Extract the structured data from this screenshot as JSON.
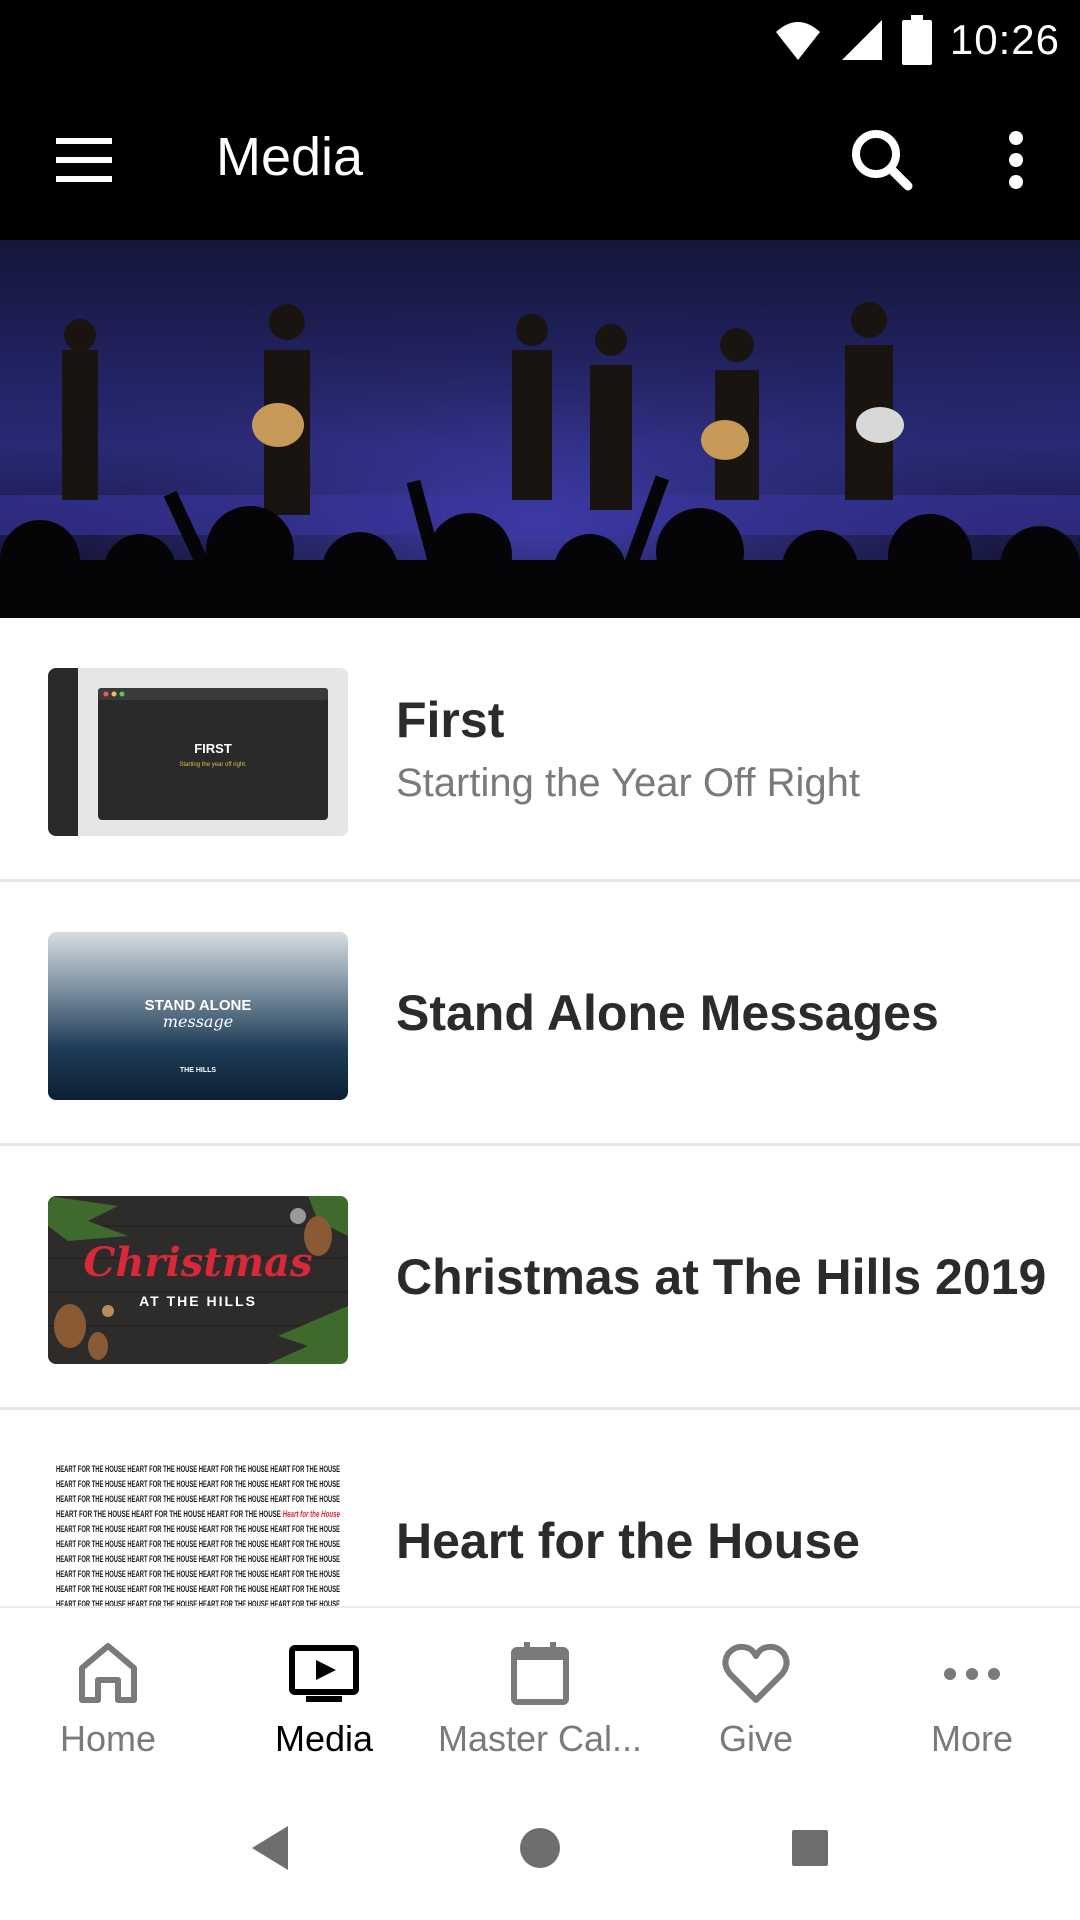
{
  "status_bar": {
    "time": "10:26",
    "icons": [
      "wifi-icon",
      "signal-icon",
      "battery-icon"
    ]
  },
  "app_bar": {
    "title": "Media",
    "icons": [
      "hamburger-menu-icon",
      "search-icon",
      "overflow-menu-icon"
    ]
  },
  "media_items": [
    {
      "title": "First",
      "subtitle": "Starting the Year Off Right",
      "thumb_text": "FIRST",
      "thumb_subtext": "Starting the year off right."
    },
    {
      "title": "Stand Alone Messages",
      "thumb_text": "STAND ALONE",
      "thumb_script": "message",
      "thumb_logo": "THE HILLS"
    },
    {
      "title": "Christmas at The Hills 2019",
      "thumb_script": "Christmas",
      "thumb_text": "AT THE HILLS"
    },
    {
      "title": "Heart for the House",
      "thumb_text": "HEART FOR THE HOUSE",
      "thumb_accent": "Heart for the House"
    }
  ],
  "bottom_nav": [
    {
      "label": "Home",
      "icon": "home-icon",
      "active": false
    },
    {
      "label": "Media",
      "icon": "media-play-icon",
      "active": true
    },
    {
      "label": "Master Cal...",
      "icon": "calendar-icon",
      "active": false
    },
    {
      "label": "Give",
      "icon": "heart-icon",
      "active": false
    },
    {
      "label": "More",
      "icon": "more-dots-icon",
      "active": false
    }
  ],
  "system_nav": [
    "back-icon",
    "home-circle-icon",
    "recents-icon"
  ],
  "colors": {
    "bar_bg": "#000000",
    "title_text": "#2b2b2b",
    "subtitle_text": "#7a7a7a",
    "nav_inactive": "#7a7a7a",
    "nav_active": "#000000",
    "christmas_red": "#d8283a"
  }
}
